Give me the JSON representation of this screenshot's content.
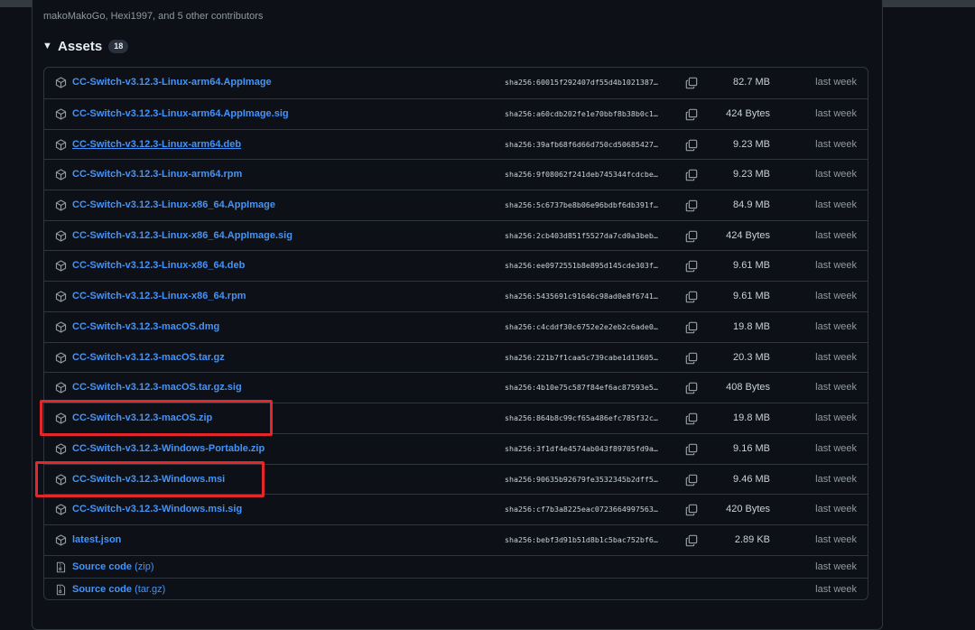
{
  "contributors_text": "makoMakoGo, Hexi1997, and 5 other contributors",
  "assets": {
    "title": "Assets",
    "count": "18",
    "items": [
      {
        "name": "CC-Switch-v3.12.3-Linux-arm64.AppImage",
        "sha": "sha256:60015f292407df55d4b1021387…",
        "size": "82.7 MB",
        "date": "last week"
      },
      {
        "name": "CC-Switch-v3.12.3-Linux-arm64.AppImage.sig",
        "sha": "sha256:a60cdb202fe1e70bbf8b38b0c1…",
        "size": "424 Bytes",
        "date": "last week"
      },
      {
        "name": "CC-Switch-v3.12.3-Linux-arm64.deb",
        "sha": "sha256:39afb68f6d66d750cd50685427…",
        "size": "9.23 MB",
        "date": "last week"
      },
      {
        "name": "CC-Switch-v3.12.3-Linux-arm64.rpm",
        "sha": "sha256:9f08062f241deb745344fcdcbe…",
        "size": "9.23 MB",
        "date": "last week"
      },
      {
        "name": "CC-Switch-v3.12.3-Linux-x86_64.AppImage",
        "sha": "sha256:5c6737be8b06e96bdbf6db391f…",
        "size": "84.9 MB",
        "date": "last week"
      },
      {
        "name": "CC-Switch-v3.12.3-Linux-x86_64.AppImage.sig",
        "sha": "sha256:2cb403d851f5527da7cd0a3beb…",
        "size": "424 Bytes",
        "date": "last week"
      },
      {
        "name": "CC-Switch-v3.12.3-Linux-x86_64.deb",
        "sha": "sha256:ee0972551b8e895d145cde303f…",
        "size": "9.61 MB",
        "date": "last week"
      },
      {
        "name": "CC-Switch-v3.12.3-Linux-x86_64.rpm",
        "sha": "sha256:5435691c91646c98ad0e8f6741…",
        "size": "9.61 MB",
        "date": "last week"
      },
      {
        "name": "CC-Switch-v3.12.3-macOS.dmg",
        "sha": "sha256:c4cddf30c6752e2e2eb2c6ade0…",
        "size": "19.8 MB",
        "date": "last week"
      },
      {
        "name": "CC-Switch-v3.12.3-macOS.tar.gz",
        "sha": "sha256:221b7f1caa5c739cabe1d13605…",
        "size": "20.3 MB",
        "date": "last week"
      },
      {
        "name": "CC-Switch-v3.12.3-macOS.tar.gz.sig",
        "sha": "sha256:4b10e75c587f84ef6ac87593e5…",
        "size": "408 Bytes",
        "date": "last week"
      },
      {
        "name": "CC-Switch-v3.12.3-macOS.zip",
        "sha": "sha256:864b8c99cf65a486efc785f32c…",
        "size": "19.8 MB",
        "date": "last week"
      },
      {
        "name": "CC-Switch-v3.12.3-Windows-Portable.zip",
        "sha": "sha256:3f1df4e4574ab043f89705fd9a…",
        "size": "9.16 MB",
        "date": "last week"
      },
      {
        "name": "CC-Switch-v3.12.3-Windows.msi",
        "sha": "sha256:90635b92679fe3532345b2dff5…",
        "size": "9.46 MB",
        "date": "last week"
      },
      {
        "name": "CC-Switch-v3.12.3-Windows.msi.sig",
        "sha": "sha256:cf7b3a8225eac0723664997563…",
        "size": "420 Bytes",
        "date": "last week"
      },
      {
        "name": "latest.json",
        "sha": "sha256:bebf3d91b51d8b1c5bac752bf6…",
        "size": "2.89 KB",
        "date": "last week"
      }
    ],
    "source": [
      {
        "name": "Source code",
        "fmt": "(zip)",
        "date": "last week"
      },
      {
        "name": "Source code",
        "fmt": "(tar.gz)",
        "date": "last week"
      }
    ]
  },
  "icons": {
    "asset": "package-icon",
    "source": "file-zip-icon",
    "copy": "copy-icon",
    "caret": "caret-down-icon"
  },
  "colors": {
    "link": "#4493f8",
    "highlight": "#e5262b",
    "background": "#0d1117"
  }
}
